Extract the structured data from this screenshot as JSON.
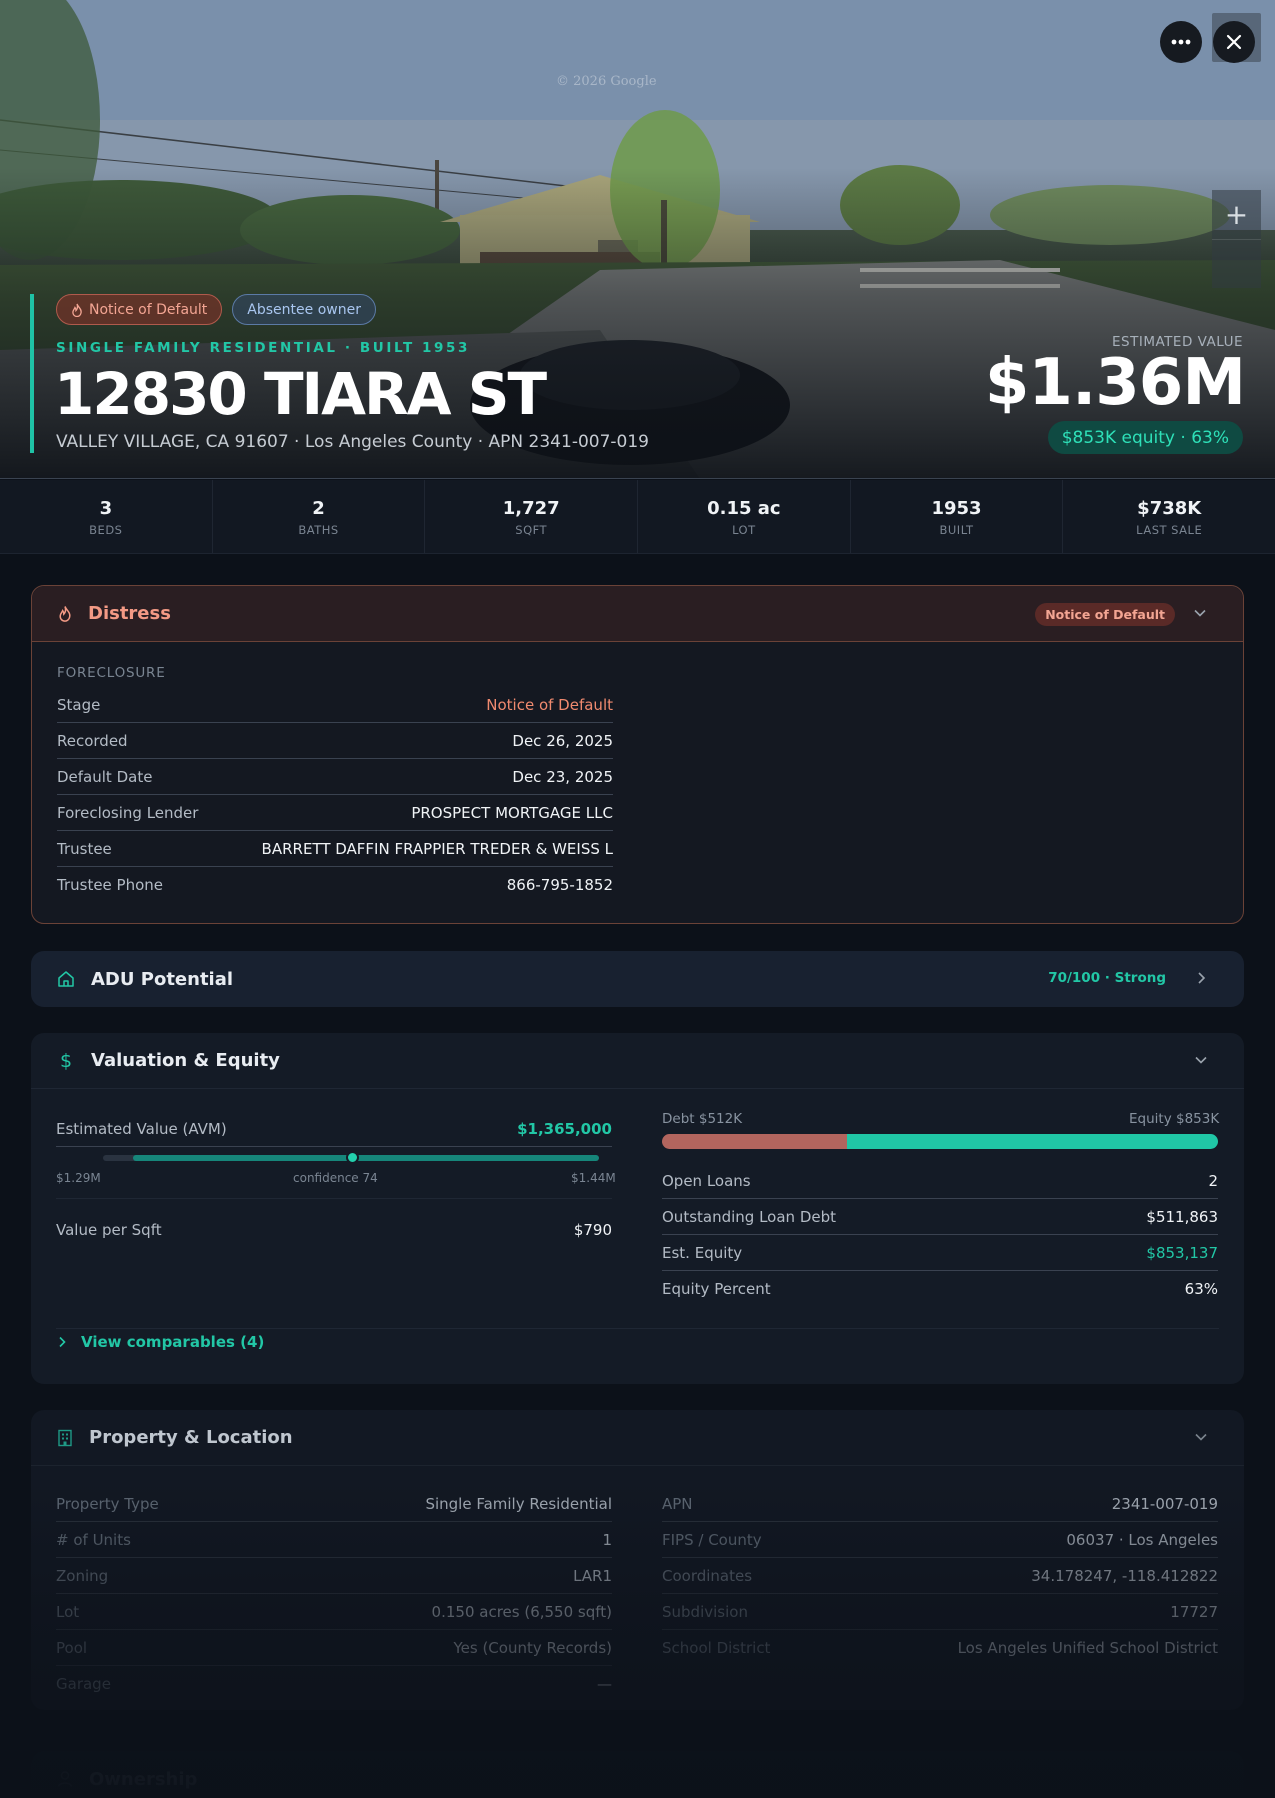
{
  "hero": {
    "watermark": "© 2026 Google",
    "badges": [
      "Notice of Default",
      "Absentee owner"
    ],
    "kicker": "SINGLE FAMILY RESIDENTIAL · BUILT 1953",
    "address": "12830 TIARA ST",
    "subaddress": "VALLEY VILLAGE, CA 91607 · Los Angeles County · APN 2341-007-019",
    "estimated_label": "ESTIMATED VALUE",
    "estimated_value": "$1.36M",
    "equity_pill": "$853K equity · 63%",
    "zoom_in": "+",
    "zoom_out": "−"
  },
  "stats": [
    {
      "value": "3",
      "label": "BEDS"
    },
    {
      "value": "2",
      "label": "BATHS"
    },
    {
      "value": "1,727",
      "label": "SQFT"
    },
    {
      "value": "0.15 ac",
      "label": "LOT"
    },
    {
      "value": "1953",
      "label": "BUILT"
    },
    {
      "value": "$738K",
      "label": "LAST SALE"
    }
  ],
  "distress": {
    "title": "Distress",
    "tag": "Notice of Default",
    "section": "FORECLOSURE",
    "rows": [
      {
        "k": "Stage",
        "v": "Notice of Default"
      },
      {
        "k": "Recorded",
        "v": "Dec 26, 2025"
      },
      {
        "k": "Default Date",
        "v": "Dec 23, 2025"
      },
      {
        "k": "Foreclosing Lender",
        "v": "PROSPECT MORTGAGE LLC"
      },
      {
        "k": "Trustee",
        "v": "BARRETT DAFFIN FRAPPIER TREDER & WEISS L"
      },
      {
        "k": "Trustee Phone",
        "v": "866-795-1852"
      }
    ]
  },
  "adu": {
    "title": "ADU Potential",
    "score": "70/100 · Strong"
  },
  "valuation": {
    "title": "Valuation & Equity",
    "avm_label": "Estimated Value (AVM)",
    "avm_value": "$1,365,000",
    "range_low": "$1.29M",
    "range_high": "$1.44M",
    "confidence": "confidence 74",
    "avm_position": 0.47,
    "sqft_label": "Value per Sqft",
    "sqft_value": "$790",
    "debt_label": "Debt $512K",
    "equity_label": "Equity $853K",
    "equity_fraction": 0.63,
    "rows": [
      {
        "k": "Open Loans",
        "v": "2"
      },
      {
        "k": "Outstanding Loan Debt",
        "v": "$511,863"
      },
      {
        "k": "Est. Equity",
        "v": "$853,137"
      },
      {
        "k": "Equity Percent",
        "v": "63%"
      }
    ],
    "comps_link": "View comparables (4)"
  },
  "property": {
    "title": "Property & Location",
    "left": [
      {
        "k": "Property Type",
        "v": "Single Family Residential"
      },
      {
        "k": "# of Units",
        "v": "1"
      },
      {
        "k": "Zoning",
        "v": "LAR1"
      },
      {
        "k": "Lot",
        "v": "0.150 acres (6,550 sqft)"
      },
      {
        "k": "Pool",
        "v": "Yes (County Records)"
      },
      {
        "k": "Garage",
        "v": "—"
      }
    ],
    "right": [
      {
        "k": "APN",
        "v": "2341-007-019"
      },
      {
        "k": "FIPS / County",
        "v": "06037 · Los Angeles"
      },
      {
        "k": "Coordinates",
        "v": "34.178247, -118.412822"
      },
      {
        "k": "Subdivision",
        "v": "17727"
      },
      {
        "k": "School District",
        "v": "Los Angeles Unified School District"
      }
    ]
  },
  "ownership": {
    "title": "Ownership"
  },
  "colors": {
    "accent": "#22c7a6",
    "distress": "#f39a85",
    "debt": "#b2655e",
    "equity": "#20c7a6"
  }
}
